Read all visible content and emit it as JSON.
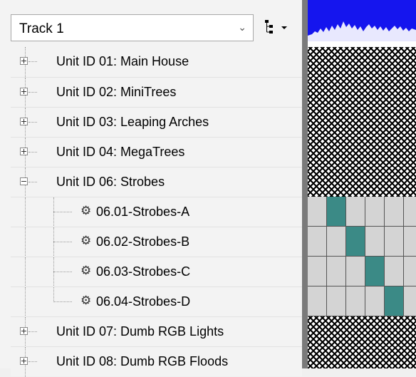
{
  "track_selector": {
    "value": "Track 1"
  },
  "toolbar": {
    "tree_options_icon": "tree-hierarchy-icon",
    "dropdown_icon": "caret-down-icon"
  },
  "tree": {
    "items": [
      {
        "label": "Unit ID 01: Main House",
        "expanded": false
      },
      {
        "label": "Unit ID 02: MiniTrees",
        "expanded": false
      },
      {
        "label": "Unit ID 03: Leaping Arches",
        "expanded": false
      },
      {
        "label": "Unit ID 04: MegaTrees",
        "expanded": false
      },
      {
        "label": "Unit ID 06: Strobes",
        "expanded": true,
        "children": [
          {
            "label": "06.01-Strobes-A",
            "icon": "gear-icon"
          },
          {
            "label": "06.02-Strobes-B",
            "icon": "gear-icon"
          },
          {
            "label": "06.03-Strobes-C",
            "icon": "gear-icon"
          },
          {
            "label": "06.04-Strobes-D",
            "icon": "gear-icon"
          }
        ]
      },
      {
        "label": "Unit ID 07: Dumb RGB Lights",
        "expanded": false
      },
      {
        "label": "Unit ID 08: Dumb RGB Floods",
        "expanded": false
      }
    ]
  },
  "colors": {
    "waveform": "#1515ee",
    "active_cell": "#3b8a86",
    "inactive_cell": "#d4d4d4"
  },
  "sequence_grid": {
    "strobe_rows_active_column": [
      1,
      2,
      3,
      4
    ]
  }
}
